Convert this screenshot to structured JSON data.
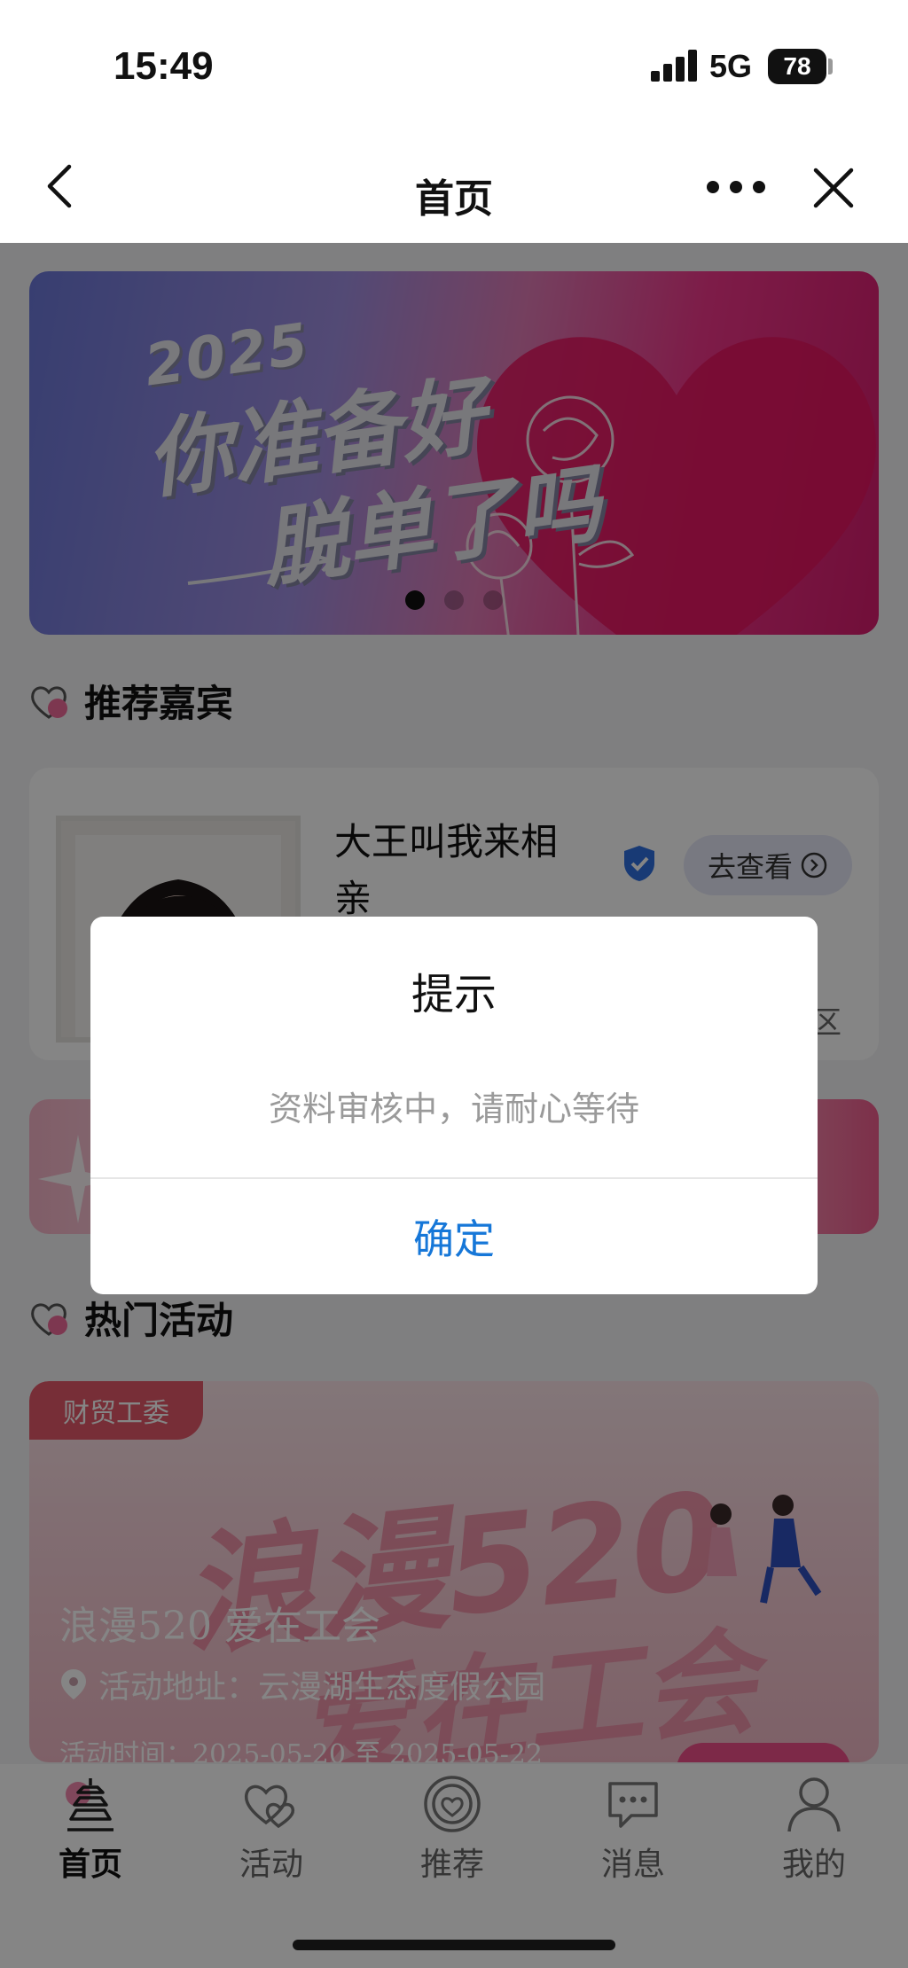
{
  "status": {
    "time": "15:49",
    "network": "5G",
    "battery": "78"
  },
  "nav": {
    "title": "首页",
    "back_icon": "chevron-left-icon",
    "more_icon": "more-dots-icon",
    "close_icon": "close-icon"
  },
  "banner": {
    "year": "2025",
    "line1": "你准备好",
    "line2": "脱单了吗",
    "slide_count": 3,
    "active_slide": 1
  },
  "recommended": {
    "title": "推荐嘉宾",
    "guest": {
      "name": "大王叫我来相亲",
      "view_label": "去查看",
      "extra": "区"
    }
  },
  "hot_activities": {
    "title": "热门活动",
    "item": {
      "tag": "财贸工委",
      "watermark_line1": "浪漫520",
      "watermark_line2": "爱在工会",
      "title": "浪漫520 爱在工会",
      "address": "活动地址：云漫湖生态度假公园",
      "time": "活动时间：2025-05-20 至 2025-05-22"
    }
  },
  "tabs": [
    {
      "label": "首页",
      "icon": "home-pagoda-icon",
      "active": true
    },
    {
      "label": "活动",
      "icon": "hearts-icon",
      "active": false
    },
    {
      "label": "推荐",
      "icon": "heart-target-icon",
      "active": false
    },
    {
      "label": "消息",
      "icon": "chat-bubble-icon",
      "active": false
    },
    {
      "label": "我的",
      "icon": "user-icon",
      "active": false
    }
  ],
  "dialog": {
    "title": "提示",
    "message": "资料审核中，请耐心等待",
    "confirm": "确定"
  },
  "colors": {
    "accent": "#1677d8",
    "overlay": "rgba(0,0,0,0.48)",
    "brand_pink": "#f0368a"
  }
}
